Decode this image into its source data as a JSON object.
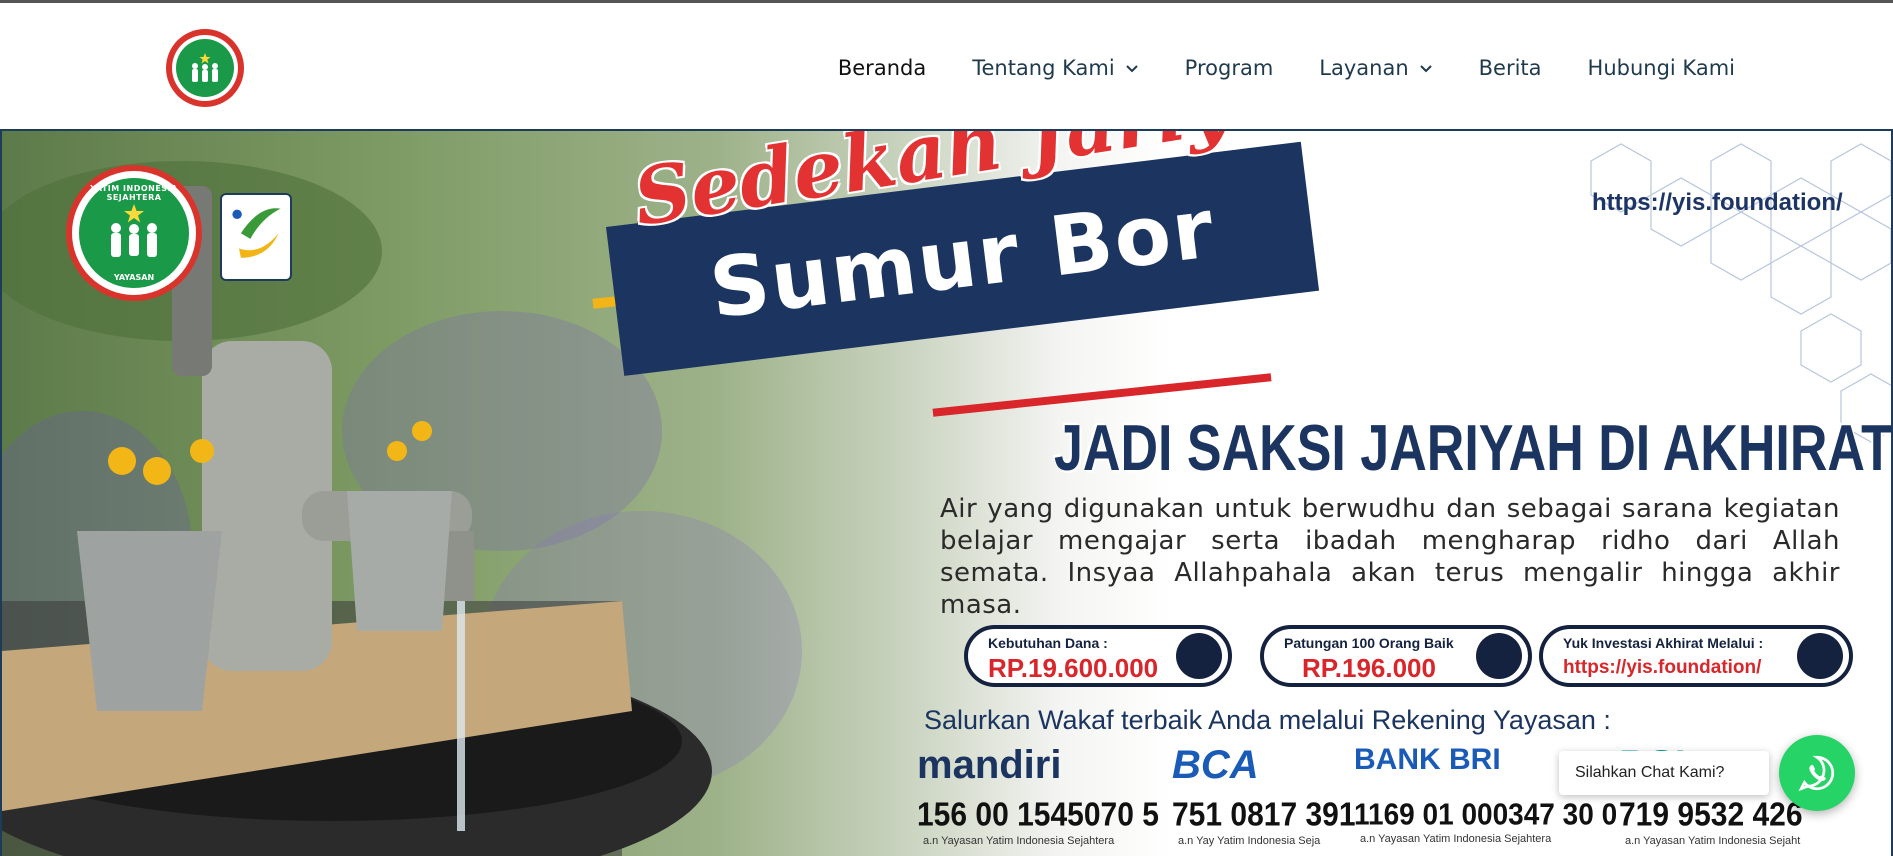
{
  "header": {
    "logo_alt": "Yayasan Yatim Indonesia Sejahtera",
    "nav": [
      {
        "label": "Beranda",
        "dropdown": false
      },
      {
        "label": "Tentang Kami",
        "dropdown": true
      },
      {
        "label": "Program",
        "dropdown": false
      },
      {
        "label": "Layanan",
        "dropdown": true
      },
      {
        "label": "Berita",
        "dropdown": false
      },
      {
        "label": "Hubungi Kami",
        "dropdown": false
      }
    ]
  },
  "banner": {
    "logo_text_top": "YATIM INDONESIA SEJAHTERA",
    "logo_text_bottom": "YAYASAN",
    "url_top": "https://yis.foundation/",
    "title_script": "Sedekah Jariyah",
    "title_main": "Sumur Bor",
    "subtitle": "JADI SAKSI JARIYAH DI AKHIRAT",
    "description": "Air yang digunakan untuk berwudhu dan sebagai sarana kegiatan belajar mengajar serta ibadah mengharap ridho dari Allah semata. Insyaa Allahpahala akan terus mengalir hingga akhir masa.",
    "pills": [
      {
        "label": "Kebutuhan Dana :",
        "value": "RP.19.600.000"
      },
      {
        "label": "Patungan 100 Orang Baik",
        "value": "RP.196.000"
      },
      {
        "label": "Yuk Investasi Akhirat Melalui :",
        "value": "https://yis.foundation/"
      }
    ],
    "salurkan": "Salurkan Wakaf terbaik Anda melalui Rekening Yayasan :",
    "banks": [
      {
        "brand": "mandiri",
        "account": "156 00 1545070 5",
        "name": "a.n Yayasan Yatim Indonesia Sejahtera",
        "color": "#1b3460"
      },
      {
        "brand": "BCA",
        "account": "751 0817 391",
        "name": "a.n Yay Yatim Indonesia Seja",
        "color": "#1a5bb8"
      },
      {
        "brand": "BANK BRI",
        "account": "1169 01 000347 30 0",
        "name": "a.n Yayasan Yatim Indonesia Sejahtera",
        "color": "#1a5bb8"
      },
      {
        "brand": "BSI",
        "account": "719 9532 426",
        "name": "a.n Yayasan Yatim Indonesia Sejaht",
        "color": "#00a39a"
      }
    ]
  },
  "chat": {
    "label": "Silahkan Chat Kami?"
  },
  "colors": {
    "nav_text": "#1f3a4d",
    "brand_green": "#1a9a48",
    "brand_red": "#d9342b",
    "navy": "#1b3460",
    "whatsapp": "#25d366"
  }
}
